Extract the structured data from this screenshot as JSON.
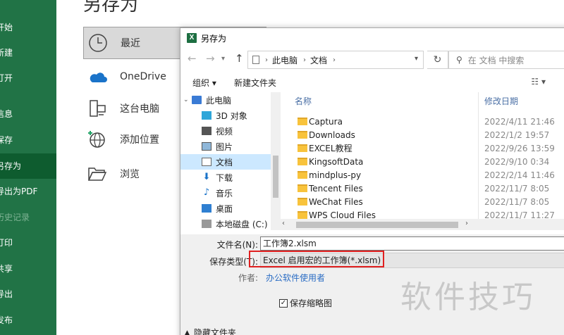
{
  "backstage": {
    "title": "另存为",
    "nav": [
      {
        "label": "开始",
        "state": "normal"
      },
      {
        "label": "新建",
        "state": "normal"
      },
      {
        "label": "打开",
        "state": "normal"
      },
      {
        "label": "信息",
        "state": "normal"
      },
      {
        "label": "保存",
        "state": "normal"
      },
      {
        "label": "另存为",
        "state": "active"
      },
      {
        "label": "导出为PDF",
        "state": "normal"
      },
      {
        "label": "历史记录",
        "state": "disabled"
      },
      {
        "label": "打印",
        "state": "normal"
      },
      {
        "label": "共享",
        "state": "normal"
      },
      {
        "label": "导出",
        "state": "normal"
      },
      {
        "label": "发布",
        "state": "normal"
      }
    ],
    "locations": [
      {
        "label": "最近",
        "icon": "clock-icon"
      },
      {
        "label": "OneDrive",
        "icon": "onedrive-cloud-icon"
      },
      {
        "label": "这台电脑",
        "icon": "computer-icon"
      },
      {
        "label": "添加位置",
        "icon": "globe-add-icon"
      },
      {
        "label": "浏览",
        "icon": "folder-open-icon"
      }
    ]
  },
  "dialog": {
    "title": "另存为",
    "address": {
      "root": "此电脑",
      "current": "文档"
    },
    "search_placeholder": "在 文档 中搜索",
    "toolbar": {
      "organize": "组织 ▾",
      "new_folder": "新建文件夹",
      "view": "☷ ▾"
    },
    "tree": [
      {
        "label": "此电脑",
        "icon": "computer-icon",
        "level": 0
      },
      {
        "label": "3D 对象",
        "icon": "cube-3d-icon",
        "level": 1
      },
      {
        "label": "视频",
        "icon": "video-icon",
        "level": 1
      },
      {
        "label": "图片",
        "icon": "picture-icon",
        "level": 1
      },
      {
        "label": "文档",
        "icon": "document-icon",
        "level": 1,
        "selected": true
      },
      {
        "label": "下载",
        "icon": "download-arrow-icon",
        "level": 1
      },
      {
        "label": "音乐",
        "icon": "music-note-icon",
        "level": 1
      },
      {
        "label": "桌面",
        "icon": "desktop-icon",
        "level": 1
      },
      {
        "label": "本地磁盘 (C:)",
        "icon": "drive-icon",
        "level": 1
      }
    ],
    "columns": {
      "name": "名称",
      "modified": "修改日期"
    },
    "files": [
      {
        "name": "Captura",
        "date": "2022/4/11 21:46"
      },
      {
        "name": "Downloads",
        "date": "2022/1/2 19:57"
      },
      {
        "name": "EXCEL教程",
        "date": "2022/9/26 13:59"
      },
      {
        "name": "KingsoftData",
        "date": "2022/9/10 0:34"
      },
      {
        "name": "mindplus-py",
        "date": "2022/2/14 11:46"
      },
      {
        "name": "Tencent Files",
        "date": "2022/11/7 8:05"
      },
      {
        "name": "WeChat Files",
        "date": "2022/11/7 8:05"
      },
      {
        "name": "WPS Cloud Files",
        "date": "2022/11/7 11:27"
      }
    ],
    "form": {
      "filename_label": "文件名(N):",
      "filename_value": "工作簿2.xlsm",
      "filetype_label": "保存类型(T):",
      "filetype_value": "Excel 启用宏的工作簿(*.xlsm)",
      "author_label": "作者:",
      "author_value": "办公软件使用者",
      "thumbnail_label": "保存缩略图",
      "thumbnail_checked": true,
      "hide_folders": "隐藏文件夹"
    }
  },
  "watermark": "软件技巧",
  "colors": {
    "excel_green": "#217346",
    "active_nav": "#0e5c2f",
    "highlight": "#e02020",
    "selected_tree": "#cce8ff"
  }
}
